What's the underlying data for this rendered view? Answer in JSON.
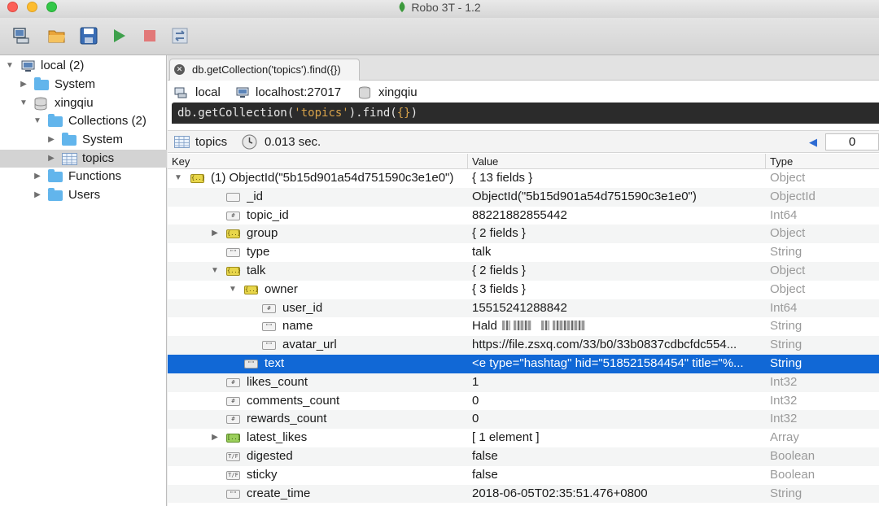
{
  "window": {
    "title": "Robo 3T - 1.2"
  },
  "toolbar": {
    "icons": [
      "connect-icon",
      "open-folder-icon",
      "save-icon",
      "run-icon",
      "stop-icon",
      "refresh-icon"
    ]
  },
  "sidebar": {
    "items": [
      {
        "label": "local (2)",
        "icon": "computer-icon"
      },
      {
        "label": "System",
        "icon": "folder-icon"
      },
      {
        "label": "xingqiu",
        "icon": "database-icon"
      },
      {
        "label": "Collections (2)",
        "icon": "folder-icon"
      },
      {
        "label": "System",
        "icon": "folder-icon"
      },
      {
        "label": "topics",
        "icon": "table-icon"
      },
      {
        "label": "Functions",
        "icon": "folder-icon"
      },
      {
        "label": "Users",
        "icon": "folder-icon"
      }
    ]
  },
  "tab": {
    "label": "db.getCollection('topics').find({})"
  },
  "connection": {
    "server": "local",
    "host": "localhost:27017",
    "database": "xingqiu"
  },
  "query": {
    "fn_prefix": "db.getCollection(",
    "collection": "'topics'",
    "fn_mid": ").find(",
    "args": "{}",
    "fn_suffix": ")"
  },
  "result": {
    "collection": "topics",
    "time": "0.013 sec.",
    "page": "0"
  },
  "grid": {
    "headers": {
      "key": "Key",
      "value": "Value",
      "type": "Type"
    },
    "rows": [
      {
        "key": "(1) ObjectId(\"5b15d901a54d751590c3e1e0\")",
        "value": "{ 13 fields }",
        "type": "Object",
        "icon": "{..}"
      },
      {
        "key": "_id",
        "value": "ObjectId(\"5b15d901a54d751590c3e1e0\")",
        "type": "ObjectId",
        "icon": ""
      },
      {
        "key": "topic_id",
        "value": "88221882855442",
        "type": "Int64",
        "icon": "#"
      },
      {
        "key": "group",
        "value": "{ 2 fields }",
        "type": "Object",
        "icon": "{..}"
      },
      {
        "key": "type",
        "value": "talk",
        "type": "String",
        "icon": "\"\""
      },
      {
        "key": "talk",
        "value": "{ 2 fields }",
        "type": "Object",
        "icon": "{..}"
      },
      {
        "key": "owner",
        "value": "{ 3 fields }",
        "type": "Object",
        "icon": "{..}"
      },
      {
        "key": "user_id",
        "value": "15515241288842",
        "type": "Int64",
        "icon": "#"
      },
      {
        "key": "name",
        "value": "Hald",
        "type": "String",
        "icon": "\"\""
      },
      {
        "key": "avatar_url",
        "value": "https://file.zsxq.com/33/b0/33b0837cdbcfdc554...",
        "type": "String",
        "icon": "\"\""
      },
      {
        "key": "text",
        "value": "<e type=\"hashtag\" hid=\"518521584454\" title=\"%...",
        "type": "String",
        "icon": "\"\""
      },
      {
        "key": "likes_count",
        "value": "1",
        "type": "Int32",
        "icon": "#"
      },
      {
        "key": "comments_count",
        "value": "0",
        "type": "Int32",
        "icon": "#"
      },
      {
        "key": "rewards_count",
        "value": "0",
        "type": "Int32",
        "icon": "#"
      },
      {
        "key": "latest_likes",
        "value": "[ 1 element ]",
        "type": "Array",
        "icon": "[..]"
      },
      {
        "key": "digested",
        "value": "false",
        "type": "Boolean",
        "icon": "T/F"
      },
      {
        "key": "sticky",
        "value": "false",
        "type": "Boolean",
        "icon": "T/F"
      },
      {
        "key": "create_time",
        "value": "2018-06-05T02:35:51.476+0800",
        "type": "String",
        "icon": "\"\""
      }
    ]
  },
  "colors": {
    "selection": "#1168d6",
    "folder": "#62b5ec",
    "query_bg": "#2b2b2b",
    "query_string": "#d7a24a"
  }
}
